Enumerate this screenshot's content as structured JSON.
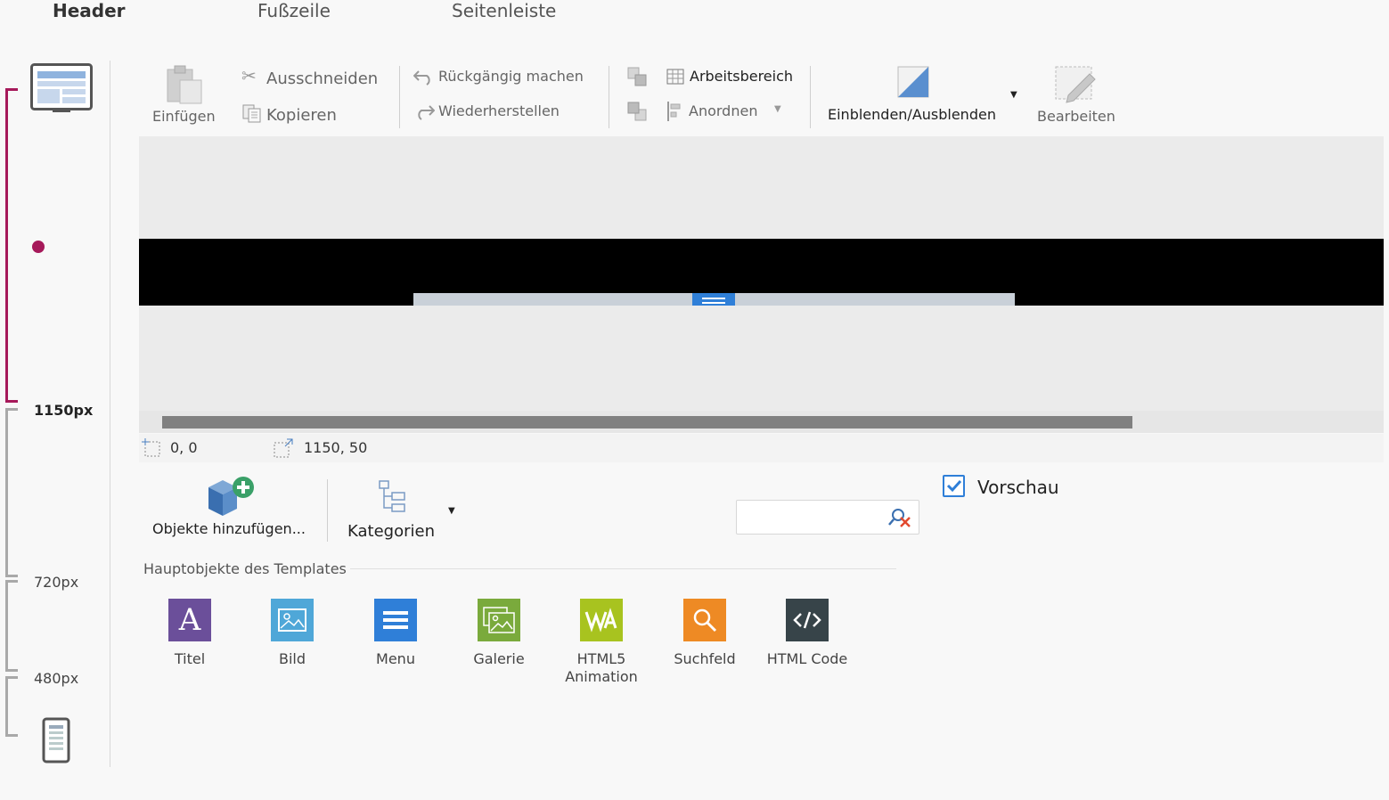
{
  "tabs": [
    {
      "label": "Header"
    },
    {
      "label": "Fußzeile"
    },
    {
      "label": "Seitenleiste"
    }
  ],
  "breakpoints": {
    "labels": [
      "1150px",
      "720px",
      "480px"
    ],
    "active_color": "#a6195a"
  },
  "toolbar": {
    "paste": "Einfügen",
    "cut": "Ausschneiden",
    "copy": "Kopieren",
    "undo": "Rückgängig machen",
    "redo": "Wiederherstellen",
    "workspace": "Arbeitsbereich",
    "arrange": "Anordnen",
    "show_hide": "Einblenden/Ausblenden",
    "edit": "Bearbeiten"
  },
  "status": {
    "position": "0, 0",
    "size": "1150, 50"
  },
  "objects_panel": {
    "add_objects": "Objekte hinzufügen...",
    "categories": "Kategorien",
    "preview_label": "Vorschau",
    "preview_checked": true,
    "search_value": "",
    "section_title": "Hauptobjekte des Templates",
    "items": [
      {
        "label": "Titel",
        "icon": "title-icon",
        "color": "#6b4f9a"
      },
      {
        "label": "Bild",
        "icon": "image-icon",
        "color": "#4fa7d8"
      },
      {
        "label": "Menu",
        "icon": "menu-icon",
        "color": "#2f7fd8"
      },
      {
        "label": "Galerie",
        "icon": "gallery-icon",
        "color": "#7aaa3c"
      },
      {
        "label": "HTML5 Animation",
        "icon": "html5-animation-icon",
        "color": "#a8c31f"
      },
      {
        "label": "Suchfeld",
        "icon": "search-icon",
        "color": "#ee8a24"
      },
      {
        "label": "HTML Code",
        "icon": "code-icon",
        "color": "#374449"
      }
    ]
  }
}
